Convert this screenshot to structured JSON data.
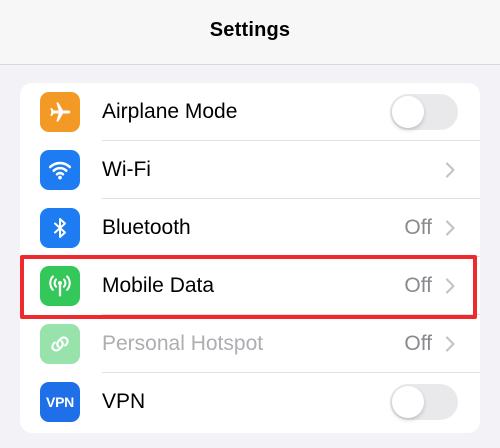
{
  "nav": {
    "title": "Settings"
  },
  "colors": {
    "airplane": "#f29a25",
    "wifi": "#1e7cf2",
    "bluetooth": "#1e7cf2",
    "mobile_data": "#34c759",
    "hotspot": "#34c759",
    "vpn": "#1e6fe8",
    "highlight": "#ee2a2f"
  },
  "rows": [
    {
      "label": "Airplane Mode",
      "icon": "airplane-icon",
      "control": "toggle",
      "toggle_on": false
    },
    {
      "label": "Wi-Fi",
      "icon": "wifi-icon",
      "control": "chevron",
      "value": ""
    },
    {
      "label": "Bluetooth",
      "icon": "bluetooth-icon",
      "control": "chevron",
      "value": "Off"
    },
    {
      "label": "Mobile Data",
      "icon": "antenna-icon",
      "control": "chevron",
      "value": "Off",
      "highlighted": true
    },
    {
      "label": "Personal Hotspot",
      "icon": "hotspot-link-icon",
      "control": "chevron",
      "value": "Off",
      "disabled": true
    },
    {
      "label": "VPN",
      "icon": "vpn-icon",
      "icon_text": "VPN",
      "control": "toggle",
      "toggle_on": false
    }
  ]
}
